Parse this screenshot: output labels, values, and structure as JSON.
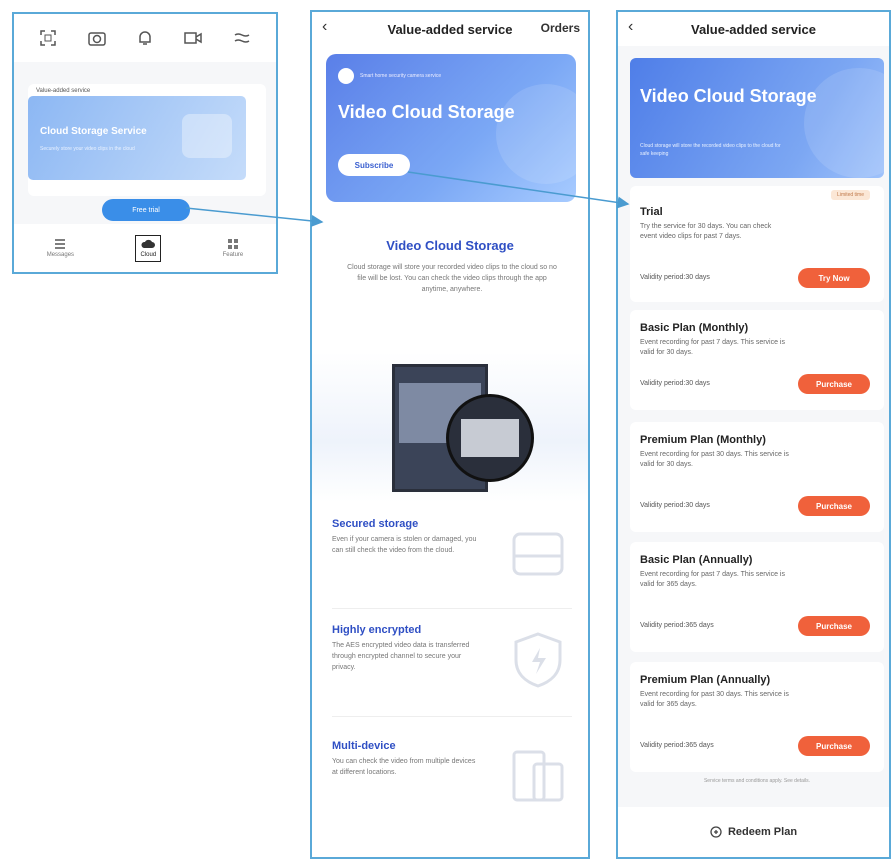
{
  "panel1": {
    "toolbar_icons": [
      "scan-icon",
      "camera-icon",
      "bell-icon",
      "video-icon",
      "more-icon"
    ],
    "card_header": "Value-added service",
    "banner_title": "Cloud Storage Service",
    "banner_sub": "Securely store your video clips in the cloud",
    "free_trial_label": "Free trial",
    "nav": [
      {
        "label": "Messages",
        "icon": "list-icon"
      },
      {
        "label": "Cloud",
        "icon": "cloud-icon"
      },
      {
        "label": "Feature",
        "icon": "grid-icon"
      }
    ]
  },
  "panel2": {
    "title": "Value-added service",
    "orders": "Orders",
    "brand_text": "Smart home security camera service",
    "banner_title": "Video Cloud Storage",
    "subscribe_label": "Subscribe",
    "section_title": "Video Cloud Storage",
    "section_desc": "Cloud storage will store your recorded video clips to the cloud so no file will be lost. You can check the video clips through the app anytime, anywhere.",
    "features": [
      {
        "title": "Secured storage",
        "desc": "Even if your camera is stolen or damaged, you can still check the video from the cloud."
      },
      {
        "title": "Highly encrypted",
        "desc": "The AES encrypted video data is transferred through encrypted channel to secure your privacy."
      },
      {
        "title": "Multi-device",
        "desc": "You can check the video from multiple devices at different locations."
      }
    ]
  },
  "panel3": {
    "title": "Value-added service",
    "banner_title": "Video Cloud Storage",
    "banner_sub": "Cloud storage will store the recorded video clips to the cloud for safe keeping",
    "plans": [
      {
        "tag": "Limited time",
        "name": "Trial",
        "desc": "Try the service for 30 days. You can check event video clips for past 7 days.",
        "validity": "Validity period:30 days",
        "button": "Try Now"
      },
      {
        "name": "Basic Plan (Monthly)",
        "desc": "Event recording for past 7 days. This service is valid for 30 days.",
        "validity": "Validity period:30 days",
        "button": "Purchase"
      },
      {
        "name": "Premium Plan (Monthly)",
        "desc": "Event recording for past 30 days. This service is valid for 30 days.",
        "validity": "Validity period:30 days",
        "button": "Purchase"
      },
      {
        "name": "Basic Plan (Annually)",
        "desc": "Event recording for past 7 days. This service is valid for 365 days.",
        "validity": "Validity period:365 days",
        "button": "Purchase"
      },
      {
        "name": "Premium Plan (Annually)",
        "desc": "Event recording for past 30 days. This service is valid for 365 days.",
        "validity": "Validity period:365 days",
        "button": "Purchase"
      }
    ],
    "note": "Service terms and conditions apply. See details.",
    "redeem_label": "Redeem Plan"
  },
  "colors": {
    "accent_blue": "#2f4fc4",
    "button_orange": "#f0613b",
    "frame_border": "#5aa9d8"
  }
}
